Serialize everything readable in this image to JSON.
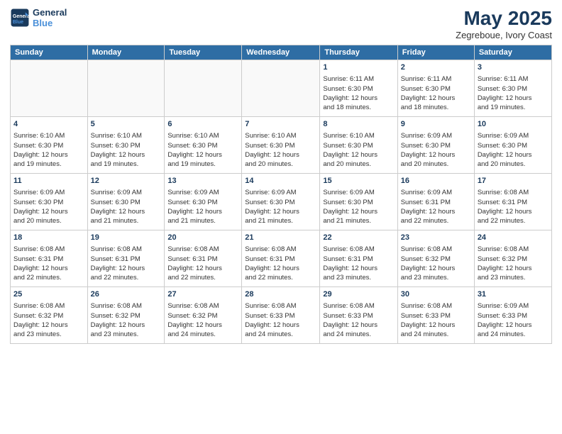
{
  "logo": {
    "line1": "General",
    "line2": "Blue"
  },
  "title": "May 2025",
  "subtitle": "Zegreboue, Ivory Coast",
  "days_header": [
    "Sunday",
    "Monday",
    "Tuesday",
    "Wednesday",
    "Thursday",
    "Friday",
    "Saturday"
  ],
  "weeks": [
    [
      {
        "day": "",
        "info": ""
      },
      {
        "day": "",
        "info": ""
      },
      {
        "day": "",
        "info": ""
      },
      {
        "day": "",
        "info": ""
      },
      {
        "day": "1",
        "info": "Sunrise: 6:11 AM\nSunset: 6:30 PM\nDaylight: 12 hours\nand 18 minutes."
      },
      {
        "day": "2",
        "info": "Sunrise: 6:11 AM\nSunset: 6:30 PM\nDaylight: 12 hours\nand 18 minutes."
      },
      {
        "day": "3",
        "info": "Sunrise: 6:11 AM\nSunset: 6:30 PM\nDaylight: 12 hours\nand 19 minutes."
      }
    ],
    [
      {
        "day": "4",
        "info": "Sunrise: 6:10 AM\nSunset: 6:30 PM\nDaylight: 12 hours\nand 19 minutes."
      },
      {
        "day": "5",
        "info": "Sunrise: 6:10 AM\nSunset: 6:30 PM\nDaylight: 12 hours\nand 19 minutes."
      },
      {
        "day": "6",
        "info": "Sunrise: 6:10 AM\nSunset: 6:30 PM\nDaylight: 12 hours\nand 19 minutes."
      },
      {
        "day": "7",
        "info": "Sunrise: 6:10 AM\nSunset: 6:30 PM\nDaylight: 12 hours\nand 20 minutes."
      },
      {
        "day": "8",
        "info": "Sunrise: 6:10 AM\nSunset: 6:30 PM\nDaylight: 12 hours\nand 20 minutes."
      },
      {
        "day": "9",
        "info": "Sunrise: 6:09 AM\nSunset: 6:30 PM\nDaylight: 12 hours\nand 20 minutes."
      },
      {
        "day": "10",
        "info": "Sunrise: 6:09 AM\nSunset: 6:30 PM\nDaylight: 12 hours\nand 20 minutes."
      }
    ],
    [
      {
        "day": "11",
        "info": "Sunrise: 6:09 AM\nSunset: 6:30 PM\nDaylight: 12 hours\nand 20 minutes."
      },
      {
        "day": "12",
        "info": "Sunrise: 6:09 AM\nSunset: 6:30 PM\nDaylight: 12 hours\nand 21 minutes."
      },
      {
        "day": "13",
        "info": "Sunrise: 6:09 AM\nSunset: 6:30 PM\nDaylight: 12 hours\nand 21 minutes."
      },
      {
        "day": "14",
        "info": "Sunrise: 6:09 AM\nSunset: 6:30 PM\nDaylight: 12 hours\nand 21 minutes."
      },
      {
        "day": "15",
        "info": "Sunrise: 6:09 AM\nSunset: 6:30 PM\nDaylight: 12 hours\nand 21 minutes."
      },
      {
        "day": "16",
        "info": "Sunrise: 6:09 AM\nSunset: 6:31 PM\nDaylight: 12 hours\nand 22 minutes."
      },
      {
        "day": "17",
        "info": "Sunrise: 6:08 AM\nSunset: 6:31 PM\nDaylight: 12 hours\nand 22 minutes."
      }
    ],
    [
      {
        "day": "18",
        "info": "Sunrise: 6:08 AM\nSunset: 6:31 PM\nDaylight: 12 hours\nand 22 minutes."
      },
      {
        "day": "19",
        "info": "Sunrise: 6:08 AM\nSunset: 6:31 PM\nDaylight: 12 hours\nand 22 minutes."
      },
      {
        "day": "20",
        "info": "Sunrise: 6:08 AM\nSunset: 6:31 PM\nDaylight: 12 hours\nand 22 minutes."
      },
      {
        "day": "21",
        "info": "Sunrise: 6:08 AM\nSunset: 6:31 PM\nDaylight: 12 hours\nand 22 minutes."
      },
      {
        "day": "22",
        "info": "Sunrise: 6:08 AM\nSunset: 6:31 PM\nDaylight: 12 hours\nand 23 minutes."
      },
      {
        "day": "23",
        "info": "Sunrise: 6:08 AM\nSunset: 6:32 PM\nDaylight: 12 hours\nand 23 minutes."
      },
      {
        "day": "24",
        "info": "Sunrise: 6:08 AM\nSunset: 6:32 PM\nDaylight: 12 hours\nand 23 minutes."
      }
    ],
    [
      {
        "day": "25",
        "info": "Sunrise: 6:08 AM\nSunset: 6:32 PM\nDaylight: 12 hours\nand 23 minutes."
      },
      {
        "day": "26",
        "info": "Sunrise: 6:08 AM\nSunset: 6:32 PM\nDaylight: 12 hours\nand 23 minutes."
      },
      {
        "day": "27",
        "info": "Sunrise: 6:08 AM\nSunset: 6:32 PM\nDaylight: 12 hours\nand 24 minutes."
      },
      {
        "day": "28",
        "info": "Sunrise: 6:08 AM\nSunset: 6:33 PM\nDaylight: 12 hours\nand 24 minutes."
      },
      {
        "day": "29",
        "info": "Sunrise: 6:08 AM\nSunset: 6:33 PM\nDaylight: 12 hours\nand 24 minutes."
      },
      {
        "day": "30",
        "info": "Sunrise: 6:08 AM\nSunset: 6:33 PM\nDaylight: 12 hours\nand 24 minutes."
      },
      {
        "day": "31",
        "info": "Sunrise: 6:09 AM\nSunset: 6:33 PM\nDaylight: 12 hours\nand 24 minutes."
      }
    ]
  ]
}
